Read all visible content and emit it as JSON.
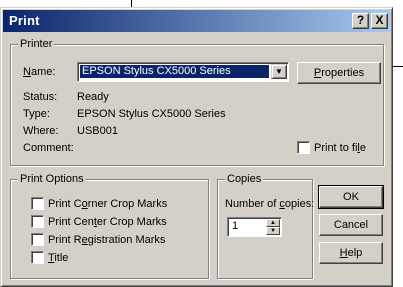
{
  "dialog": {
    "title": "Print",
    "help_button": "?",
    "close_button": "X"
  },
  "printer": {
    "group_label": "Printer",
    "name_label": "Name:",
    "name_value": "EPSON Stylus CX5000 Series",
    "properties_button": "Properties",
    "status_label": "Status:",
    "status_value": "Ready",
    "type_label": "Type:",
    "type_value": "EPSON Stylus CX5000 Series",
    "where_label": "Where:",
    "where_value": "USB001",
    "comment_label": "Comment:",
    "print_to_file_label": "Print to file",
    "print_to_file_checked": false
  },
  "print_options": {
    "group_label": "Print Options",
    "items": [
      {
        "label": "Print Corner Crop Marks",
        "checked": false
      },
      {
        "label": "Print Center Crop Marks",
        "checked": false
      },
      {
        "label": "Print Registration Marks",
        "checked": false
      },
      {
        "label": "Title",
        "checked": false
      }
    ]
  },
  "copies": {
    "group_label": "Copies",
    "number_label": "Number of copies:",
    "value": "1"
  },
  "buttons": {
    "ok": "OK",
    "cancel": "Cancel",
    "help": "Help"
  },
  "colors": {
    "titlebar_start": "#0a246a",
    "titlebar_end": "#a6caf0",
    "dialog_face": "#d4d0c8",
    "selection": "#0a246a"
  }
}
